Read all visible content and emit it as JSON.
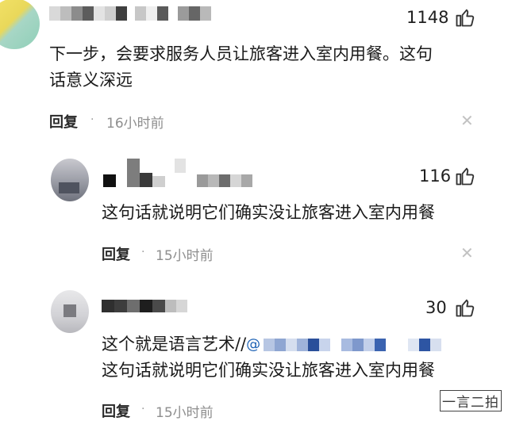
{
  "comments": [
    {
      "likes": "1148",
      "text_lines": [
        "下一步，会要求服务人员让旅客进入室内用餐。这句",
        "话意义深远"
      ],
      "reply_label": "回复",
      "time": "16小时前"
    },
    {
      "likes": "116",
      "text_lines": [
        "这句话就说明它们确实没让旅客进入室内用餐"
      ],
      "reply_label": "回复",
      "time": "15小时前"
    },
    {
      "likes": "30",
      "text_prefix": "这个就是语言艺术//",
      "quoted_line": "这句话就说明它们确实没让旅客进入室内用餐",
      "reply_label": "回复",
      "time": "15小时前"
    }
  ],
  "watermark": "一言二拍",
  "colors": {
    "like_icon": "#333333",
    "time_gray": "#8e8e8e",
    "mention_blue": "#1e63b5"
  },
  "icons": [
    "thumbs-up-icon",
    "close-icon"
  ]
}
